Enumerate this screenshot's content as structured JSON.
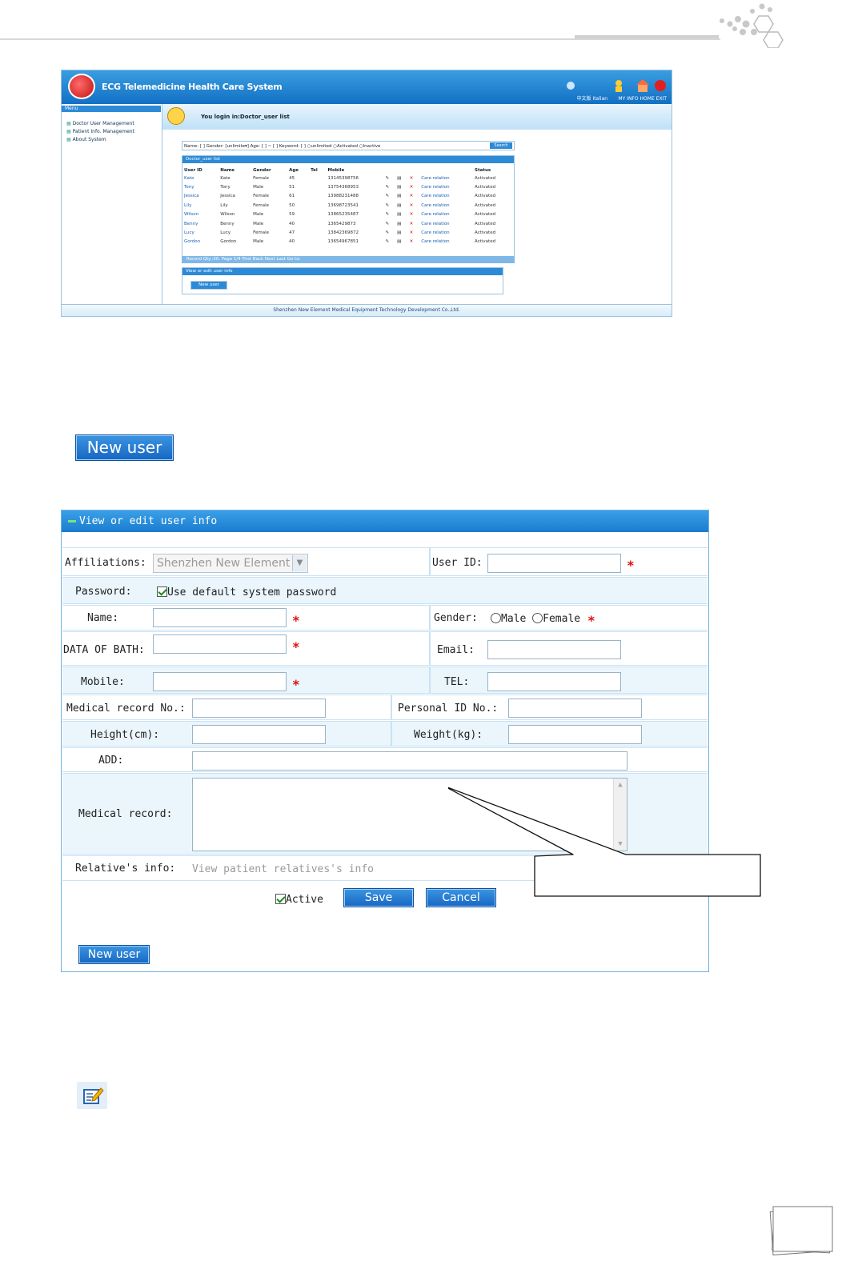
{
  "mini_screenshot": {
    "app_title": "ECG Telemedicine Health Care System",
    "top_links": [
      "中文版",
      "Italian",
      "MY INFO",
      "HOME",
      "EXIT"
    ],
    "menu_header": "Menu",
    "menu_items": [
      "Doctor User Management",
      "Patient Info. Management",
      "About System"
    ],
    "login_text": "You login in:Doctor_user list",
    "search_text": "Name: [    ] Gender: [unlimite▾] Age: [  ] ~ [  ] Keyword: [     ] ○unlimited ○Activated ○Inactive",
    "search_button": "Search",
    "list_title": "Doctor_user list",
    "columns": [
      "User ID",
      "Name",
      "Gender",
      "Age",
      "Tel",
      "Mobile",
      "",
      "",
      "",
      "",
      "Status"
    ],
    "rows": [
      {
        "id": "Kate",
        "name": "Kate",
        "gender": "Female",
        "age": "45",
        "mobile": "13145398756",
        "care": "Care relation",
        "status": "Activated"
      },
      {
        "id": "Tony",
        "name": "Tony",
        "gender": "Male",
        "age": "51",
        "mobile": "13754368953",
        "care": "Care relation",
        "status": "Activated"
      },
      {
        "id": "Jessica",
        "name": "Jessica",
        "gender": "Female",
        "age": "61",
        "mobile": "13988231488",
        "care": "Care relation",
        "status": "Activated"
      },
      {
        "id": "Lily",
        "name": "Lily",
        "gender": "Female",
        "age": "50",
        "mobile": "13698723541",
        "care": "Care relation",
        "status": "Activated"
      },
      {
        "id": "Wilson",
        "name": "Wilson",
        "gender": "Male",
        "age": "59",
        "mobile": "13865235487",
        "care": "Care relation",
        "status": "Activated"
      },
      {
        "id": "Benny",
        "name": "Benny",
        "gender": "Male",
        "age": "40",
        "mobile": "1365429873",
        "care": "Care relation",
        "status": "Activated"
      },
      {
        "id": "Lucy",
        "name": "Lucy",
        "gender": "Female",
        "age": "47",
        "mobile": "13842369872",
        "care": "Care relation",
        "status": "Activated"
      },
      {
        "id": "Gordon",
        "name": "Gordon",
        "gender": "Male",
        "age": "40",
        "mobile": "13654967851",
        "care": "Care relation",
        "status": "Activated"
      }
    ],
    "pager_text": "Record Qty.:30.   Page 1/4  First  Back  Next   Last  Go to:",
    "edit_title": "View or edit user info",
    "new_user_button": "New user",
    "footer": "Shenzhen New Element Medical Equipment Technology Development Co.,Ltd."
  },
  "new_user_button_large": "New user",
  "form": {
    "title": "View or edit user info",
    "affiliations_label": "Affiliations:",
    "affiliations_value": "Shenzhen New Element M",
    "user_id_label": "User ID:",
    "password_label": "Password:",
    "default_password_label": "Use default system password",
    "name_label": "Name:",
    "gender_label": "Gender:",
    "gender_male": "Male",
    "gender_female": "Female",
    "dob_label": "DATA OF BATH:",
    "email_label": "Email:",
    "mobile_label": "Mobile:",
    "tel_label": "TEL:",
    "medical_record_no_label": "Medical record No.:",
    "personal_id_label": "Personal ID No.:",
    "height_label": "Height(cm):",
    "weight_label": "Weight(kg):",
    "add_label": "ADD:",
    "medical_record_label": "Medical record:",
    "relatives_label": "Relative's info:",
    "relatives_link": "View patient relatives's info",
    "active_label": "Active",
    "save_button": "Save",
    "cancel_button": "Cancel",
    "new_user_button": "New user",
    "required_mark": "*"
  },
  "colors": {
    "accent_blue": "#1a7ccf",
    "required_red": "#e01010",
    "row_alt": "#eaf5fc"
  }
}
